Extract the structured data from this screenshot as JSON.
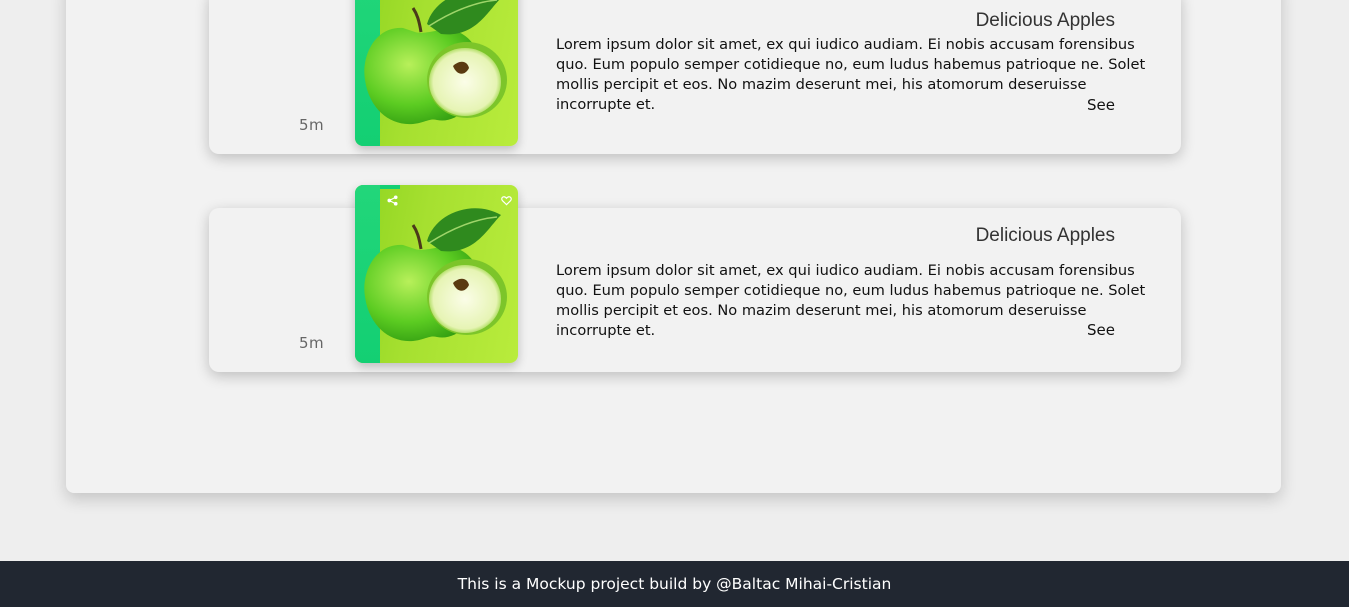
{
  "cards": [
    {
      "time": "5m",
      "title": "Delicious Apples",
      "description": "Lorem ipsum dolor sit amet, ex qui iudico audiam. Ei nobis accusam forensibus quo. Eum populo semper cotidieque no, eum ludus habemus patrioque ne. Solet mollis percipit et eos. No mazim deserunt mei, his atomorum deseruisse incorrupte et.",
      "see_label": "See",
      "image": "green-apples-image"
    },
    {
      "time": "5m",
      "title": "Delicious Apples",
      "description": "Lorem ipsum dolor sit amet, ex qui iudico audiam. Ei nobis accusam forensibus quo. Eum populo semper cotidieque no, eum ludus habemus patrioque ne. Solet mollis percipit et eos. No mazim deserunt mei, his atomorum deseruisse incorrupte et.",
      "see_label": "See",
      "image": "green-apples-image",
      "icons": [
        "share-icon",
        "heart-icon"
      ]
    }
  ],
  "footer": {
    "text": "This is a Mockup project build by @Baltac Mihai-Cristian"
  },
  "colors": {
    "page_bg": "#eeeeee",
    "card_bg": "#f2f2f2",
    "accent_green": "#13cf73",
    "image_green": "#a6e030",
    "footer_bg": "#212731",
    "footer_text": "#ffffff"
  }
}
